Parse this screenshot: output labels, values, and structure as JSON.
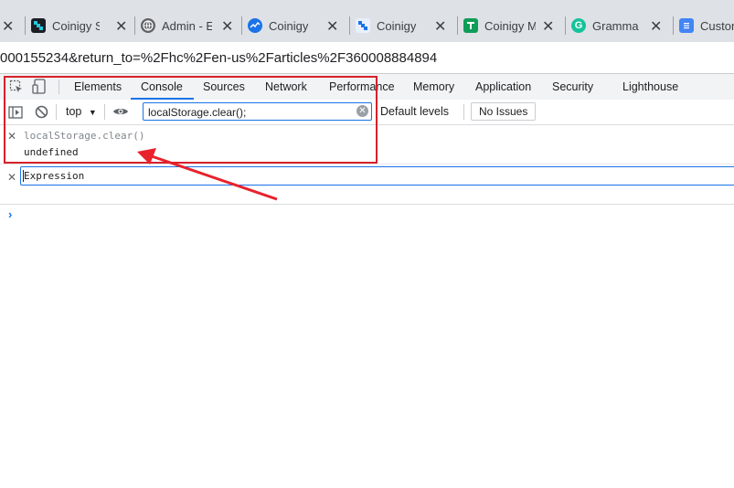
{
  "browser": {
    "tabs": [
      {
        "title": "",
        "icon": "close-icon"
      },
      {
        "title": "Coinigy S",
        "icon": "coinigy-icon",
        "color": "#26c6da"
      },
      {
        "title": "Admin - E",
        "icon": "globe-icon",
        "color": "#5f6368"
      },
      {
        "title": "Coinigy",
        "icon": "coinigy-chart-icon",
        "color": "#1a73e8"
      },
      {
        "title": "Coinigy",
        "icon": "coinigy-icon",
        "color": "#1a73e8"
      },
      {
        "title": "Coinigy M",
        "icon": "sheets-icon",
        "color": "#0f9d58"
      },
      {
        "title": "Gramma",
        "icon": "grammarly-icon",
        "color": "#15c39a"
      },
      {
        "title": "Custom",
        "icon": "docs-icon",
        "color": "#4285f4"
      }
    ],
    "address": "000155234&return_to=%2Fhc%2Fen-us%2Farticles%2F360008884894"
  },
  "devtools": {
    "tabs": [
      "Elements",
      "Console",
      "Sources",
      "Network",
      "Performance",
      "Memory",
      "Application",
      "Security",
      "Lighthouse"
    ],
    "active_tab": "Console",
    "toolbar": {
      "context": "top",
      "filter_value": "localStorage.clear();",
      "levels": "Default levels",
      "issues": "No Issues"
    },
    "console": {
      "command": "localStorage.clear()",
      "result": "undefined",
      "expression_placeholder": "Expression"
    }
  },
  "annotation": {
    "color": "#d7212a"
  }
}
